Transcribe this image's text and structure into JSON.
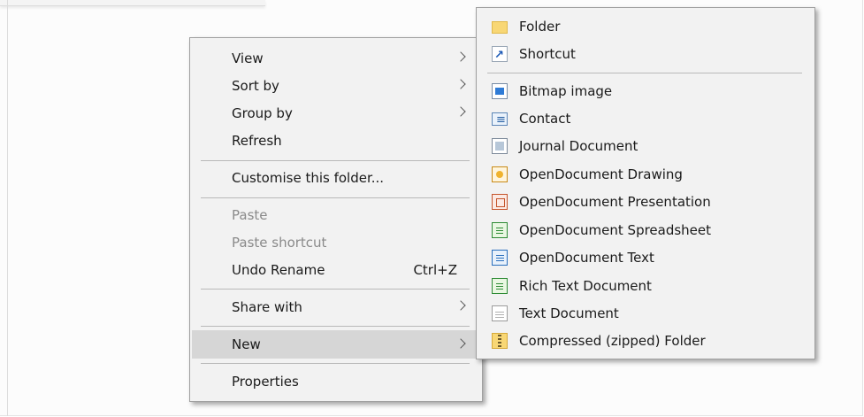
{
  "context_menu": {
    "view": "View",
    "sort_by": "Sort by",
    "group_by": "Group by",
    "refresh": "Refresh",
    "customise": "Customise this folder...",
    "paste": "Paste",
    "paste_shortcut": "Paste shortcut",
    "undo_rename": "Undo Rename",
    "undo_rename_shortcut": "Ctrl+Z",
    "share_with": "Share with",
    "new": "New",
    "properties": "Properties"
  },
  "new_submenu": {
    "items": [
      {
        "label": "Folder",
        "icon": "folder-icon"
      },
      {
        "label": "Shortcut",
        "icon": "shortcut-icon"
      },
      {
        "label": "Bitmap image",
        "icon": "bitmap-icon"
      },
      {
        "label": "Contact",
        "icon": "contact-icon"
      },
      {
        "label": "Journal Document",
        "icon": "journal-icon"
      },
      {
        "label": "OpenDocument Drawing",
        "icon": "odg-icon"
      },
      {
        "label": "OpenDocument Presentation",
        "icon": "odp-icon"
      },
      {
        "label": "OpenDocument Spreadsheet",
        "icon": "ods-icon"
      },
      {
        "label": "OpenDocument Text",
        "icon": "odt-icon"
      },
      {
        "label": "Rich Text Document",
        "icon": "rtf-icon"
      },
      {
        "label": "Text Document",
        "icon": "text-icon"
      },
      {
        "label": "Compressed (zipped) Folder",
        "icon": "zip-folder-icon"
      }
    ]
  },
  "colors": {
    "menu_bg": "#f2f2f2",
    "highlight": "#d6d6d6",
    "disabled_text": "#8a8a8a"
  }
}
